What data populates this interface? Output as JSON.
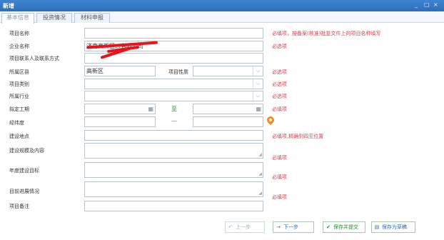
{
  "window": {
    "title": "新增",
    "minimize": "_",
    "maximize": "□",
    "close": "×"
  },
  "tabs": [
    {
      "label": "基本信息",
      "active": true
    },
    {
      "label": "投资情况",
      "active": false
    },
    {
      "label": "材料申报",
      "active": false
    }
  ],
  "form": {
    "project_name": {
      "label": "项目名称",
      "value": "",
      "hint": "必填项，按备案(核准)批复文件上的项目名称填写"
    },
    "company_name": {
      "label": "企业名称",
      "value": "济南高新区…有限公司",
      "hint": "必选项"
    },
    "contact": {
      "label": "项目联系人及联系方式",
      "value": ""
    },
    "district": {
      "label": "所属区县",
      "value": "高新区",
      "hint": "必选项"
    },
    "project_nature": {
      "label": "项目性质",
      "value": ""
    },
    "category": {
      "label": "项目类别",
      "value": "",
      "hint": "必选项"
    },
    "industry": {
      "label": "所属行业",
      "value": "",
      "hint": "必选项"
    },
    "period": {
      "label": "拟定工期",
      "start": "",
      "sep": "至",
      "end": "",
      "hint": "必填项"
    },
    "lnglat": {
      "label": "经纬度",
      "lng": "",
      "sep": "—",
      "lat": ""
    },
    "location": {
      "label": "建设地点",
      "value": "",
      "hint": "必填项,精确到四至位置"
    },
    "scale": {
      "label": "建设规模及内容",
      "value": "",
      "hint": "必填项"
    },
    "annual_goal": {
      "label": "年度建设目标",
      "value": "",
      "hint": "必填项"
    },
    "progress": {
      "label": "目前进展情况",
      "value": "",
      "hint": "必填项"
    },
    "remarks": {
      "label": "项目备注",
      "value": ""
    }
  },
  "buttons": {
    "prev": {
      "label": "上一步",
      "icon": "↶"
    },
    "next": {
      "label": "下一步",
      "icon": "→"
    },
    "save_submit": {
      "label": "保存并提交",
      "icon": "✔"
    },
    "save_draft": {
      "label": "保存为草稿",
      "icon": "▤"
    }
  },
  "colors": {
    "titlebar": "#2f74c0",
    "hint": "#e0404a",
    "separator": "#2a9a2a",
    "pin": "#f28a1e"
  }
}
